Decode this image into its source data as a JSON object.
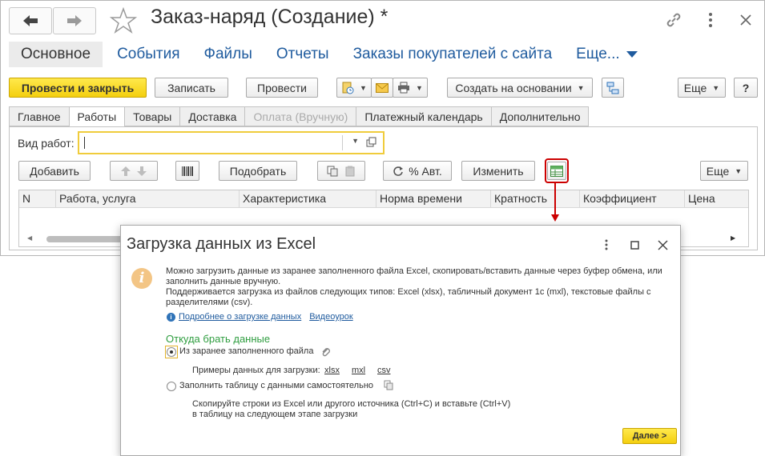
{
  "window": {
    "title": "Заказ-наряд (Создание) *",
    "nav_tabs": [
      {
        "label": "Основное"
      },
      {
        "label": "События"
      },
      {
        "label": "Файлы"
      },
      {
        "label": "Отчеты"
      },
      {
        "label": "Заказы покупателей с сайта"
      },
      {
        "label": "Еще..."
      }
    ]
  },
  "toolbar": {
    "post_close_label": "Провести и закрыть",
    "save_label": "Записать",
    "post_label": "Провести",
    "create_based_label": "Создать на основании",
    "more_label": "Еще",
    "help_label": "?"
  },
  "tabs": [
    {
      "label": "Главное"
    },
    {
      "label": "Работы"
    },
    {
      "label": "Товары"
    },
    {
      "label": "Доставка"
    },
    {
      "label": "Оплата (Вручную)"
    },
    {
      "label": "Платежный календарь"
    },
    {
      "label": "Дополнительно"
    }
  ],
  "works": {
    "vid_label": "Вид работ:",
    "vid_value": "",
    "add_label": "Добавить",
    "select_label": "Подобрать",
    "auto_label": "% Авт.",
    "change_label": "Изменить",
    "more_label": "Еще",
    "columns": [
      "N",
      "Работа, услуга",
      "Характеристика",
      "Норма времени",
      "Кратность",
      "Коэффициент",
      "Цена"
    ]
  },
  "dialog": {
    "title": "Загрузка данных из Excel",
    "info_line1": "Можно загрузить данные из заранее заполненного файла Excel, скопировать/вставить данные через буфер обмена, или",
    "info_line2": "заполнить данные вручную.",
    "info_line3": "Поддерживается загрузка из файлов следующих типов: Excel (xlsx), табличный документ 1с (mxl), текстовые файлы с",
    "info_line4": "разделителями (csv).",
    "link_more": "Подробнее о загрузке данных",
    "link_video": "Видеоурок",
    "source_header": "Откуда брать данные",
    "option_file": "Из заранее заполненного файла",
    "examples_label": "Примеры данных для загрузки:",
    "ex_xlsx": "xlsx",
    "ex_mxl": "mxl",
    "ex_csv": "csv",
    "option_manual": "Заполнить таблицу с данными самостоятельно",
    "manual_hint1": "Скопируйте строки из Excel или другого источника (Ctrl+C) и вставьте (Ctrl+V)",
    "manual_hint2": "в таблицу на следующем этапе загрузки",
    "next_label": "Далее >"
  },
  "colors": {
    "accent_yellow": "#f4cf0f",
    "link_blue": "#1f5b9e",
    "highlight_red": "#cc0000",
    "green_header": "#2e9d3f"
  }
}
